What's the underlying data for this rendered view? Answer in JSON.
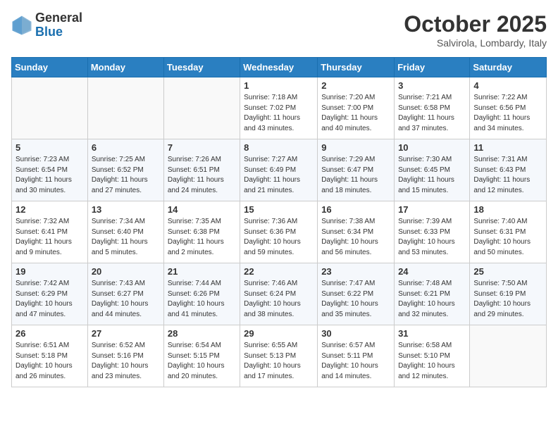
{
  "logo": {
    "general": "General",
    "blue": "Blue"
  },
  "title": "October 2025",
  "location": "Salvirola, Lombardy, Italy",
  "days_header": [
    "Sunday",
    "Monday",
    "Tuesday",
    "Wednesday",
    "Thursday",
    "Friday",
    "Saturday"
  ],
  "weeks": [
    [
      {
        "day": "",
        "info": ""
      },
      {
        "day": "",
        "info": ""
      },
      {
        "day": "",
        "info": ""
      },
      {
        "day": "1",
        "info": "Sunrise: 7:18 AM\nSunset: 7:02 PM\nDaylight: 11 hours\nand 43 minutes."
      },
      {
        "day": "2",
        "info": "Sunrise: 7:20 AM\nSunset: 7:00 PM\nDaylight: 11 hours\nand 40 minutes."
      },
      {
        "day": "3",
        "info": "Sunrise: 7:21 AM\nSunset: 6:58 PM\nDaylight: 11 hours\nand 37 minutes."
      },
      {
        "day": "4",
        "info": "Sunrise: 7:22 AM\nSunset: 6:56 PM\nDaylight: 11 hours\nand 34 minutes."
      }
    ],
    [
      {
        "day": "5",
        "info": "Sunrise: 7:23 AM\nSunset: 6:54 PM\nDaylight: 11 hours\nand 30 minutes."
      },
      {
        "day": "6",
        "info": "Sunrise: 7:25 AM\nSunset: 6:52 PM\nDaylight: 11 hours\nand 27 minutes."
      },
      {
        "day": "7",
        "info": "Sunrise: 7:26 AM\nSunset: 6:51 PM\nDaylight: 11 hours\nand 24 minutes."
      },
      {
        "day": "8",
        "info": "Sunrise: 7:27 AM\nSunset: 6:49 PM\nDaylight: 11 hours\nand 21 minutes."
      },
      {
        "day": "9",
        "info": "Sunrise: 7:29 AM\nSunset: 6:47 PM\nDaylight: 11 hours\nand 18 minutes."
      },
      {
        "day": "10",
        "info": "Sunrise: 7:30 AM\nSunset: 6:45 PM\nDaylight: 11 hours\nand 15 minutes."
      },
      {
        "day": "11",
        "info": "Sunrise: 7:31 AM\nSunset: 6:43 PM\nDaylight: 11 hours\nand 12 minutes."
      }
    ],
    [
      {
        "day": "12",
        "info": "Sunrise: 7:32 AM\nSunset: 6:41 PM\nDaylight: 11 hours\nand 9 minutes."
      },
      {
        "day": "13",
        "info": "Sunrise: 7:34 AM\nSunset: 6:40 PM\nDaylight: 11 hours\nand 5 minutes."
      },
      {
        "day": "14",
        "info": "Sunrise: 7:35 AM\nSunset: 6:38 PM\nDaylight: 11 hours\nand 2 minutes."
      },
      {
        "day": "15",
        "info": "Sunrise: 7:36 AM\nSunset: 6:36 PM\nDaylight: 10 hours\nand 59 minutes."
      },
      {
        "day": "16",
        "info": "Sunrise: 7:38 AM\nSunset: 6:34 PM\nDaylight: 10 hours\nand 56 minutes."
      },
      {
        "day": "17",
        "info": "Sunrise: 7:39 AM\nSunset: 6:33 PM\nDaylight: 10 hours\nand 53 minutes."
      },
      {
        "day": "18",
        "info": "Sunrise: 7:40 AM\nSunset: 6:31 PM\nDaylight: 10 hours\nand 50 minutes."
      }
    ],
    [
      {
        "day": "19",
        "info": "Sunrise: 7:42 AM\nSunset: 6:29 PM\nDaylight: 10 hours\nand 47 minutes."
      },
      {
        "day": "20",
        "info": "Sunrise: 7:43 AM\nSunset: 6:27 PM\nDaylight: 10 hours\nand 44 minutes."
      },
      {
        "day": "21",
        "info": "Sunrise: 7:44 AM\nSunset: 6:26 PM\nDaylight: 10 hours\nand 41 minutes."
      },
      {
        "day": "22",
        "info": "Sunrise: 7:46 AM\nSunset: 6:24 PM\nDaylight: 10 hours\nand 38 minutes."
      },
      {
        "day": "23",
        "info": "Sunrise: 7:47 AM\nSunset: 6:22 PM\nDaylight: 10 hours\nand 35 minutes."
      },
      {
        "day": "24",
        "info": "Sunrise: 7:48 AM\nSunset: 6:21 PM\nDaylight: 10 hours\nand 32 minutes."
      },
      {
        "day": "25",
        "info": "Sunrise: 7:50 AM\nSunset: 6:19 PM\nDaylight: 10 hours\nand 29 minutes."
      }
    ],
    [
      {
        "day": "26",
        "info": "Sunrise: 6:51 AM\nSunset: 5:18 PM\nDaylight: 10 hours\nand 26 minutes."
      },
      {
        "day": "27",
        "info": "Sunrise: 6:52 AM\nSunset: 5:16 PM\nDaylight: 10 hours\nand 23 minutes."
      },
      {
        "day": "28",
        "info": "Sunrise: 6:54 AM\nSunset: 5:15 PM\nDaylight: 10 hours\nand 20 minutes."
      },
      {
        "day": "29",
        "info": "Sunrise: 6:55 AM\nSunset: 5:13 PM\nDaylight: 10 hours\nand 17 minutes."
      },
      {
        "day": "30",
        "info": "Sunrise: 6:57 AM\nSunset: 5:11 PM\nDaylight: 10 hours\nand 14 minutes."
      },
      {
        "day": "31",
        "info": "Sunrise: 6:58 AM\nSunset: 5:10 PM\nDaylight: 10 hours\nand 12 minutes."
      },
      {
        "day": "",
        "info": ""
      }
    ]
  ]
}
